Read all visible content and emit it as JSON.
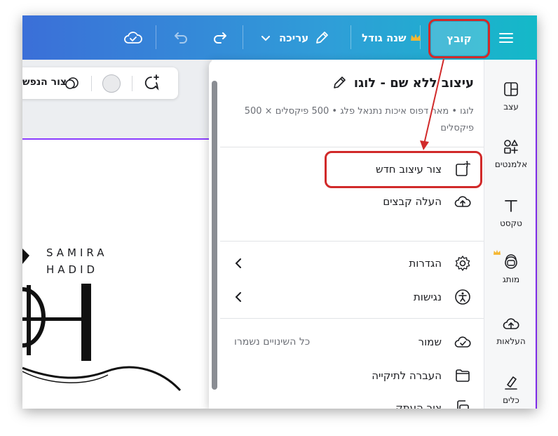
{
  "topbar": {
    "file_label": "קובץ",
    "resize_label": "שנה גודל",
    "edit_label": "עריכה",
    "icons": [
      "menu-icon",
      "crown-icon",
      "pencil-icon",
      "chevron-down-icon",
      "redo-icon",
      "undo-icon",
      "cloud-check-icon"
    ]
  },
  "sidebar": {
    "items": [
      {
        "label": "עצב",
        "icon": "layout-icon"
      },
      {
        "label": "אלמנטים",
        "icon": "shapes-icon"
      },
      {
        "label": "טקסט",
        "icon": "text-icon"
      },
      {
        "label": "מותג",
        "icon": "brand-icon"
      },
      {
        "label": "העלאות",
        "icon": "upload-icon"
      },
      {
        "label": "כלים",
        "icon": "draw-icon"
      }
    ]
  },
  "canvas_toolbar": {
    "bg_remover_label": "צור הנפש"
  },
  "logo": {
    "line1": "SAMIRA",
    "line2": "HADID"
  },
  "panel": {
    "title": "עיצוב ללא שם - לוגו",
    "subtitle": "לוגו • מאר דפוס איכות נתנאל פלג • 500 פיקסלים × 500 פיקסלים",
    "items": [
      {
        "label": "צור עיצוב חדש",
        "icon": "plus-icon"
      },
      {
        "label": "העלה קבצים",
        "icon": "cloud-upload-icon"
      },
      {
        "label": "הגדרות",
        "icon": "settings-icon"
      },
      {
        "label": "נגישות",
        "icon": "accessibility-icon"
      },
      {
        "label": "שמור",
        "icon": "cloud-check-icon",
        "note": "כל השינויים נשמרו"
      },
      {
        "label": "העברה לתיקייה",
        "icon": "folder-icon"
      },
      {
        "label": "צור העתק",
        "icon": "copy-icon"
      }
    ]
  },
  "colors": {
    "annotation_red": "#d12a2a",
    "topbar_start": "#3b6fd8",
    "topbar_end": "#14b9c8",
    "accent_purple": "#7d2ae8"
  }
}
